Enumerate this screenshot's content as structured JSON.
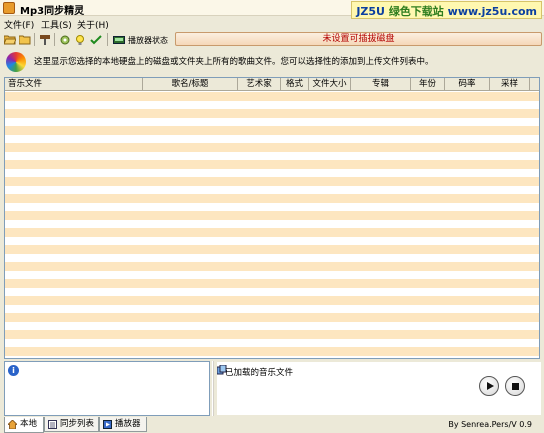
{
  "window": {
    "title": "Mp3同步精灵",
    "watermark": {
      "code": "JZ5U",
      "cn": "绿色下载站",
      "url": "www.jz5u.com"
    }
  },
  "menu": [
    {
      "label": "文件(F)"
    },
    {
      "label": "工具(S)"
    },
    {
      "label": "关于(H)"
    }
  ],
  "toolbar": {
    "buttons": [
      {
        "icon": "open-folder-icon"
      },
      {
        "icon": "folder-icon"
      },
      {
        "icon": "tools-icon"
      },
      {
        "icon": "sync-icon"
      },
      {
        "icon": "lightbulb-icon"
      },
      {
        "icon": "check-icon"
      },
      {
        "icon": "player-status-icon"
      }
    ],
    "status_label": "播放器状态",
    "status_value": "未设置可插拔磁盘",
    "status_color": "#b30000"
  },
  "info": {
    "text": "这里显示您选择的本地硬盘上的磁盘或文件夹上所有的歌曲文件。您可以选择性的添加到上传文件列表中。"
  },
  "table": {
    "columns": [
      "音乐文件",
      "歌名/标题",
      "艺术家",
      "格式",
      "文件大小",
      "专辑",
      "年份",
      "码率",
      "采样"
    ],
    "row_colors": [
      "#fde6c0",
      "#ffffff"
    ],
    "rows": []
  },
  "bottom": {
    "loaded_label": "已加载的音乐文件",
    "play_label": "播放",
    "stop_label": "停止"
  },
  "tabs": [
    {
      "label": "本地",
      "active": true
    },
    {
      "label": "同步列表",
      "active": false
    },
    {
      "label": "播放器",
      "active": false
    }
  ],
  "version": "By Senrea.Pers/V 0.9"
}
